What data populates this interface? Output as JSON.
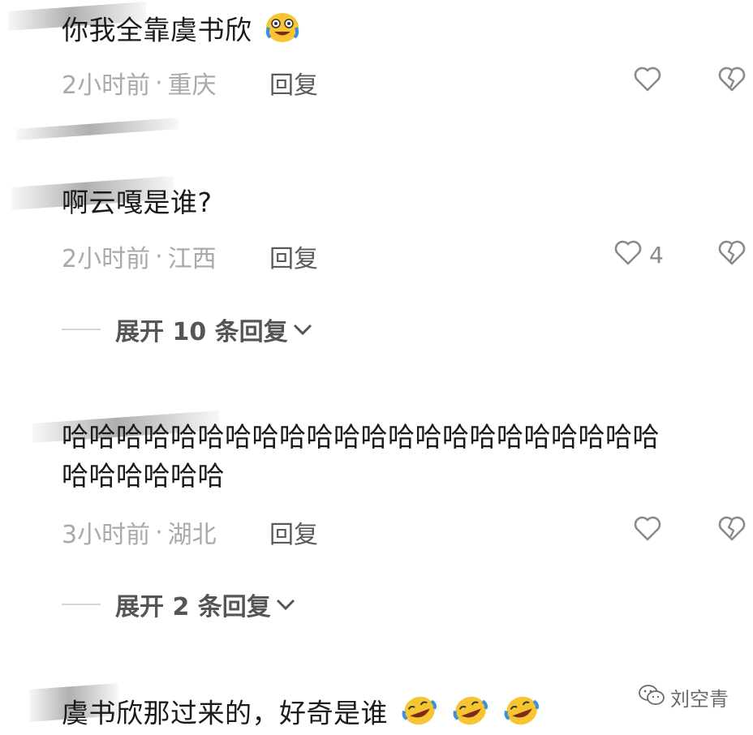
{
  "comments": [
    {
      "text": "你我全靠虞书欣",
      "time": "2小时前",
      "location": "重庆",
      "reply_label": "回复",
      "emoji": "laughing-crying-emoji"
    },
    {
      "text": "啊云嘎是谁?",
      "time": "2小时前",
      "location": "江西",
      "reply_label": "回复",
      "like_count": "4",
      "expand_label": "展开 10 条回复"
    },
    {
      "text_line1": "哈哈哈哈哈哈哈哈哈哈哈哈哈哈哈哈哈哈哈哈哈哈",
      "text_line2": "哈哈哈哈哈哈",
      "time": "3小时前",
      "location": "湖北",
      "reply_label": "回复",
      "expand_label": "展开 2 条回复"
    },
    {
      "text": "虞书欣那过来的，好奇是谁",
      "emoji": "rolling-laughing-emoji"
    }
  ],
  "watermark": {
    "label": "刘空青",
    "icon": "wechat-icon"
  },
  "colors": {
    "text": "#1a1a1a",
    "meta": "#a9a9a9",
    "reply": "#5a5a5a",
    "icon": "#8a8a8a",
    "emoji_yellow": "#f7c531",
    "emoji_blue": "#3b8fe0"
  }
}
